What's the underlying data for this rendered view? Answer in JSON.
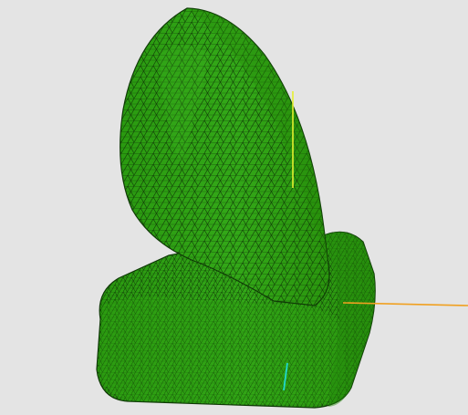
{
  "viewer": {
    "background_color": "#e4e4e4",
    "mesh": {
      "fill_color": "#2ea112",
      "shade_color": "#248a0a",
      "highlight_color": "#3cb41e",
      "edge_color": "#0f3a06",
      "render_mode": "surface-with-edges",
      "element_type": "triangle"
    },
    "axes": {
      "x_color": "#f0a020",
      "y_color": "#e6f030",
      "z_color": "#20d8d0"
    }
  }
}
